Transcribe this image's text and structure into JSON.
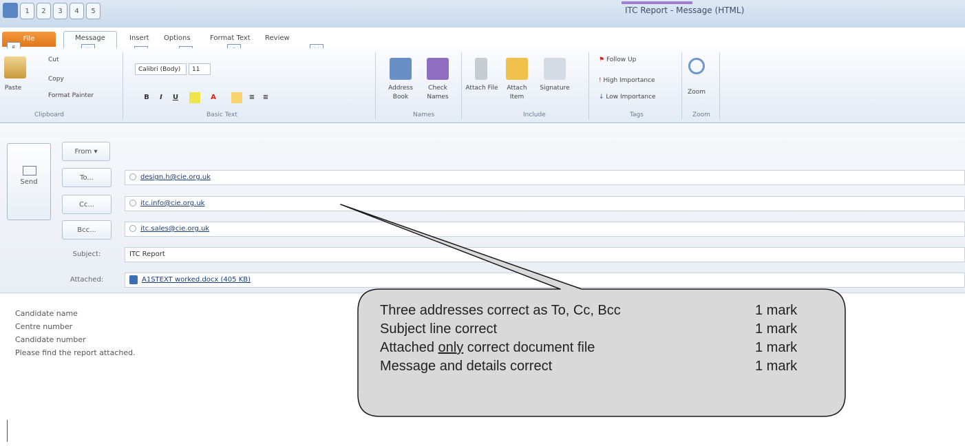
{
  "window": {
    "title": "ITC Report - Message (HTML)",
    "qat_keys": [
      "1",
      "2",
      "3",
      "4",
      "5"
    ]
  },
  "tabs": [
    {
      "label": "File",
      "keytip": "F"
    },
    {
      "label": "Message",
      "keytip": "H"
    },
    {
      "label": "Insert",
      "keytip": "N"
    },
    {
      "label": "Options",
      "keytip": "P"
    },
    {
      "label": "Format Text",
      "keytip": "O"
    },
    {
      "label": "Review",
      "keytip": "V"
    }
  ],
  "ribbon": {
    "clipboard": {
      "paste": "Paste",
      "cut": "Cut",
      "copy": "Copy",
      "format_painter": "Format Painter",
      "label": "Clipboard"
    },
    "basic_text": {
      "font": "Calibri (Body)",
      "size": "11",
      "label": "Basic Text",
      "bold": "B",
      "italic": "I",
      "underline": "U"
    },
    "names": {
      "address_book": "Address Book",
      "check_names": "Check Names",
      "label": "Names"
    },
    "include": {
      "attach_file": "Attach File",
      "attach_item": "Attach Item",
      "signature": "Signature",
      "label": "Include"
    },
    "tags": {
      "follow_up": "Follow Up",
      "high_importance": "High Importance",
      "low_importance": "Low Importance",
      "label": "Tags"
    },
    "zoom": {
      "zoom": "Zoom",
      "label": "Zoom"
    }
  },
  "compose": {
    "send": "Send",
    "from": "From",
    "to_label": "To...",
    "cc_label": "Cc...",
    "bcc_label": "Bcc...",
    "subject_label": "Subject:",
    "attached_label": "Attached:",
    "to": "design.h@cie.org.uk",
    "cc": "itc.info@cie.org.uk",
    "bcc": "itc.sales@cie.org.uk",
    "subject": "ITC Report",
    "attachment": "A1STEXT worked.docx (405 KB)"
  },
  "body": {
    "lines": [
      "Candidate name",
      "Centre number",
      "Candidate number",
      "Please find the report attached."
    ]
  },
  "callout": {
    "rows": [
      {
        "pre": "Three addresses correct as To, Cc, Bcc",
        "u": "",
        "post": "",
        "mark": "1 mark"
      },
      {
        "pre": "Subject line correct",
        "u": "",
        "post": "",
        "mark": "1 mark"
      },
      {
        "pre": "Attached ",
        "u": "only",
        "post": " correct document file",
        "mark": "1 mark"
      },
      {
        "pre": "Message and details correct",
        "u": "",
        "post": "",
        "mark": "1 mark"
      }
    ]
  }
}
